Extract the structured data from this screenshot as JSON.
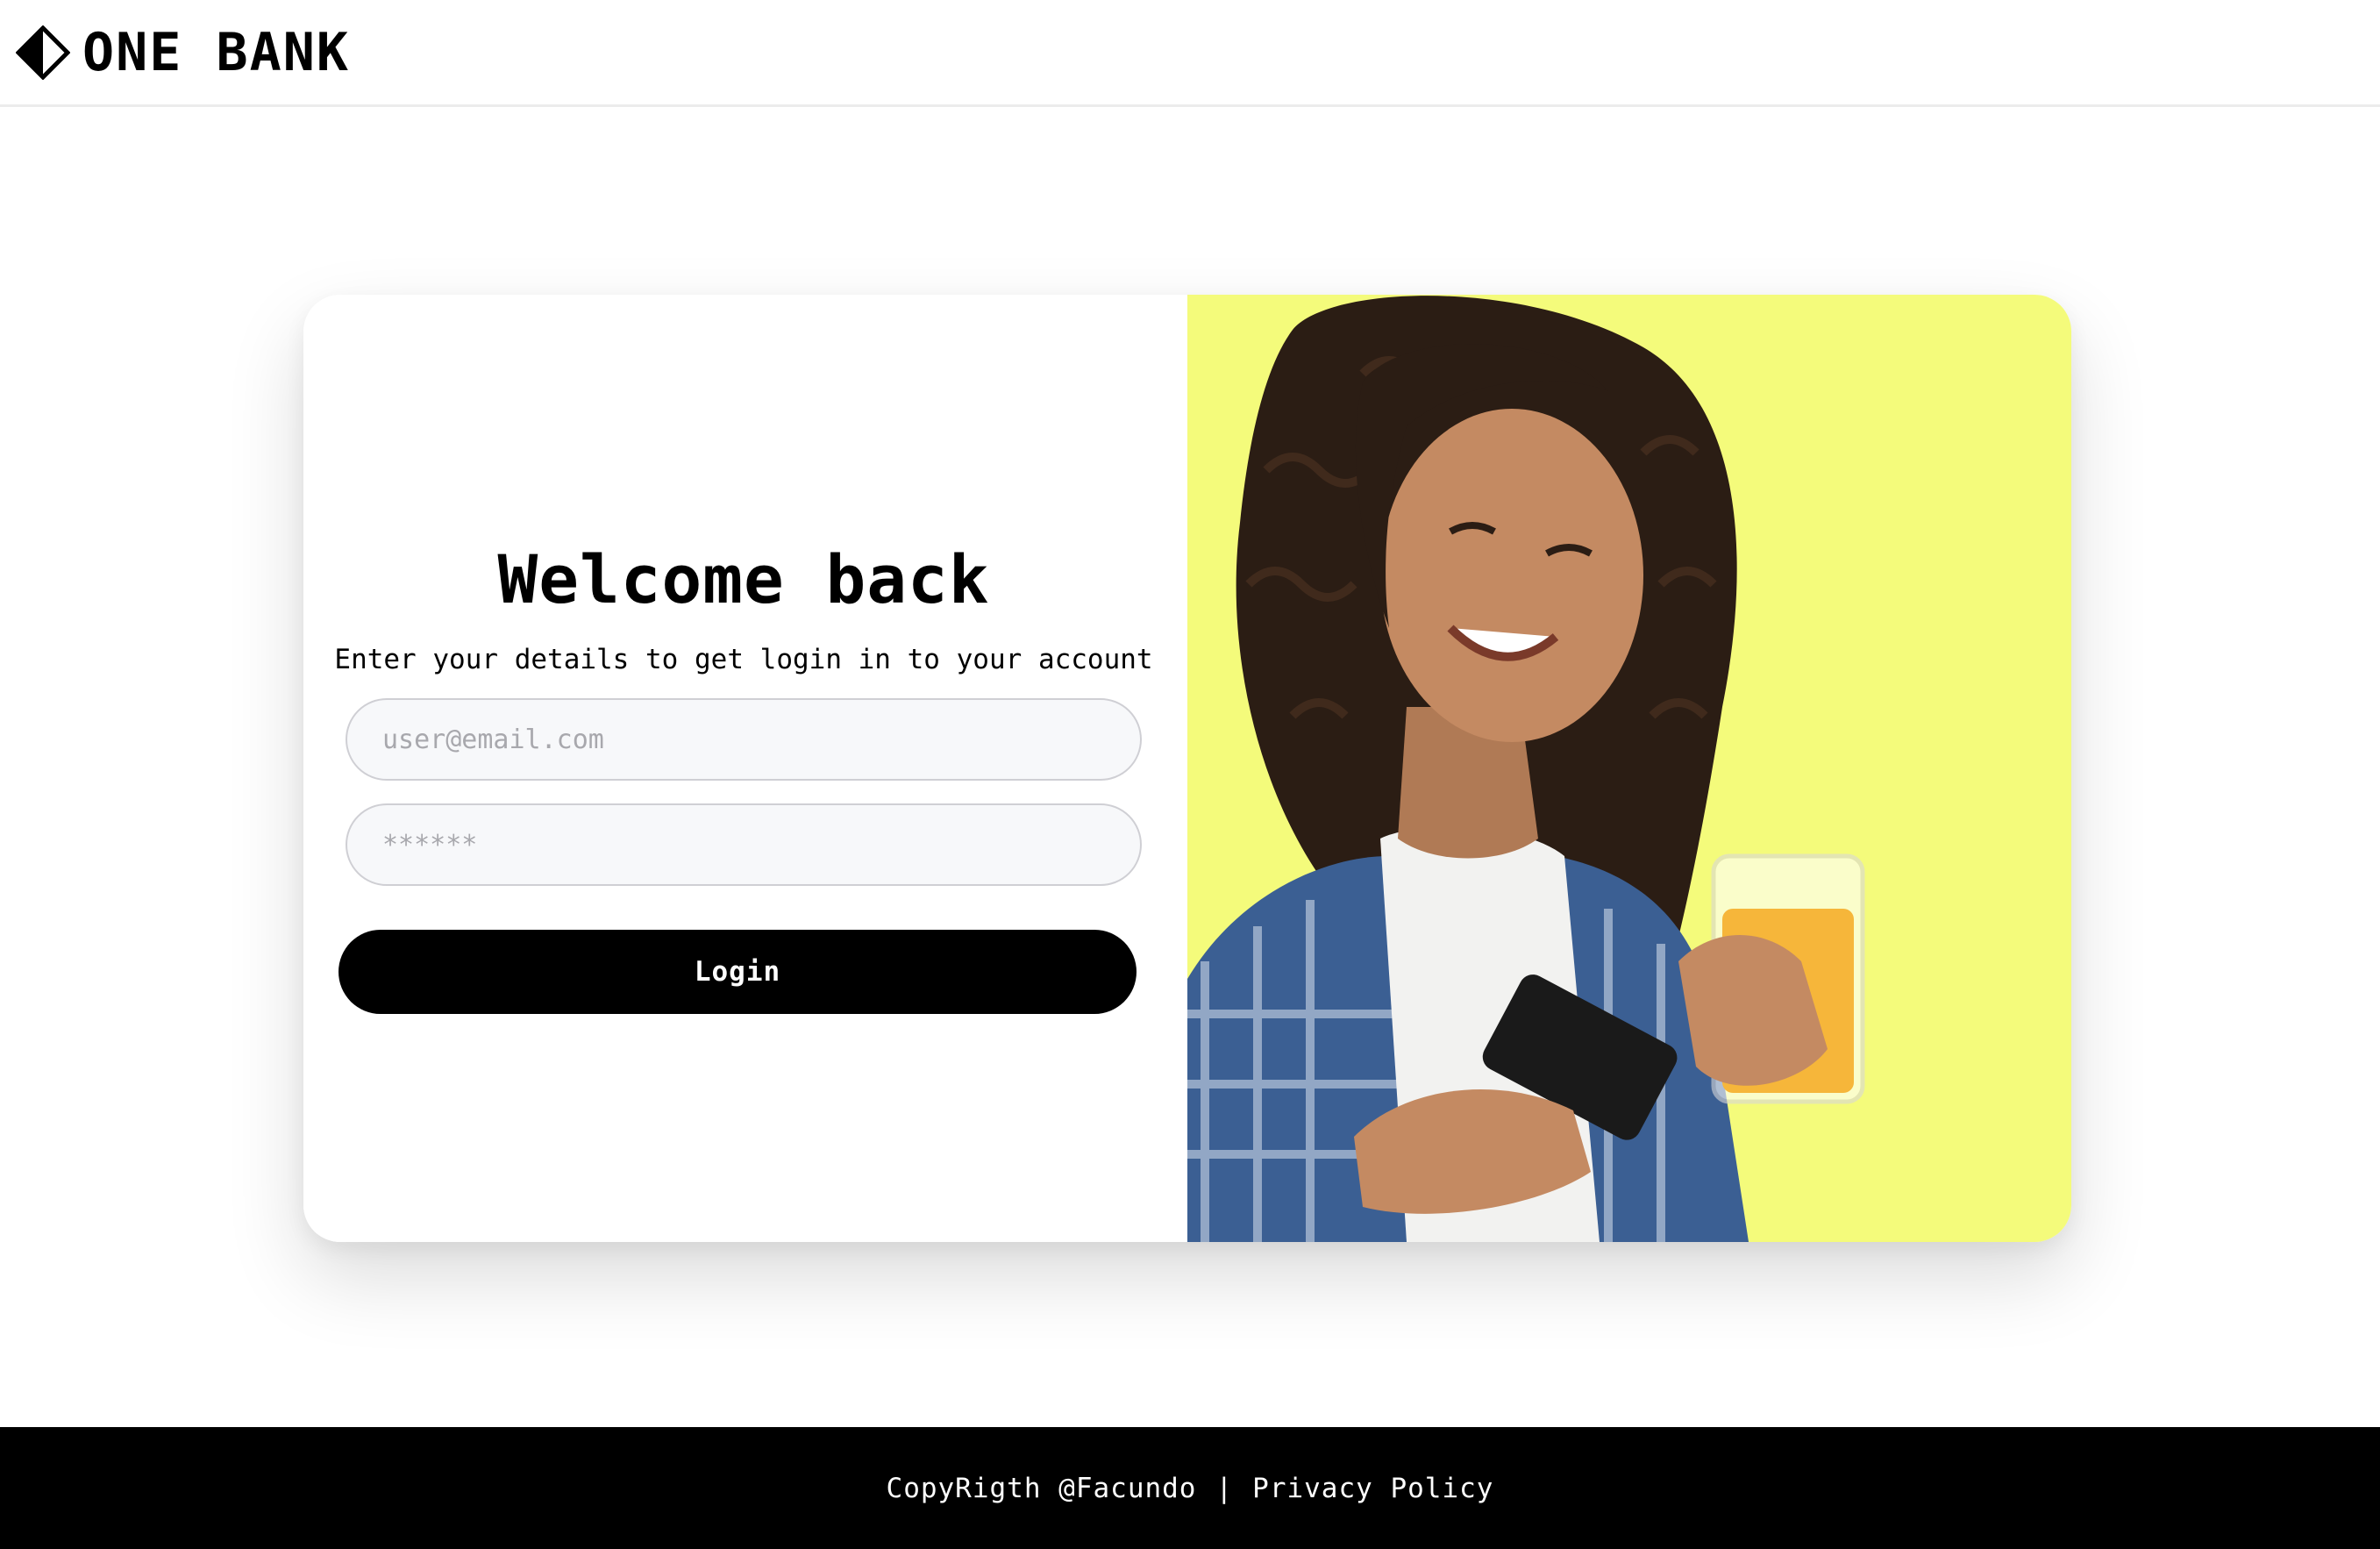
{
  "header": {
    "brand": "ONE BANK",
    "logo_icon": "diamond-half-icon"
  },
  "login": {
    "title": "Welcome back",
    "subtitle": "Enter your details to get login in to your account",
    "email_placeholder": "user@email.com",
    "password_placeholder": "******",
    "submit_label": "Login"
  },
  "hero": {
    "image": "woman-with-phone-and-juice",
    "background_color": "#f4fb7b"
  },
  "footer": {
    "copyright": "CopyRigth @Facundo",
    "separator": "|",
    "privacy_label": "Privacy Policy"
  }
}
